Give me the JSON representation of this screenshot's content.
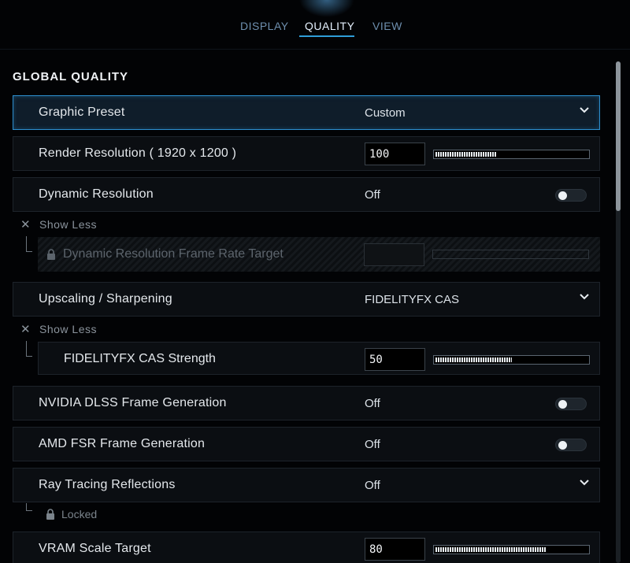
{
  "tabs": [
    {
      "label": "DISPLAY",
      "active": false
    },
    {
      "label": "QUALITY",
      "active": true
    },
    {
      "label": "VIEW",
      "active": false
    }
  ],
  "section_title": "GLOBAL QUALITY",
  "rows": {
    "graphic_preset": {
      "label": "Graphic Preset",
      "value": "Custom"
    },
    "render_resolution": {
      "label": "Render Resolution ( 1920 x 1200 )",
      "value": "100",
      "level": 0.4
    },
    "dynamic_resolution": {
      "label": "Dynamic Resolution",
      "value": "Off",
      "on": false
    },
    "dynamic_show_less": "Show Less",
    "dynamic_frame_rate": {
      "label": "Dynamic Resolution Frame Rate Target",
      "locked": true
    },
    "upscaling": {
      "label": "Upscaling / Sharpening",
      "value": "FIDELITYFX CAS"
    },
    "upscaling_show_less": "Show Less",
    "cas_strength": {
      "label": "FIDELITYFX CAS Strength",
      "value": "50",
      "level": 0.5
    },
    "dlss_frame_gen": {
      "label": "NVIDIA DLSS Frame Generation",
      "value": "Off",
      "on": false
    },
    "fsr_frame_gen": {
      "label": "AMD FSR Frame Generation",
      "value": "Off",
      "on": false
    },
    "ray_tracing": {
      "label": "Ray Tracing Reflections",
      "value": "Off"
    },
    "ray_tracing_locked": "Locked",
    "vram_scale": {
      "label": "VRAM Scale Target",
      "value": "80",
      "level": 0.73
    }
  },
  "colors": {
    "accent": "#2f9ed8",
    "row_bg": "#0b0e12",
    "selected_bg": "#0f1d2a"
  },
  "icons": [
    "chevron-down-icon",
    "close-icon",
    "lock-icon"
  ]
}
